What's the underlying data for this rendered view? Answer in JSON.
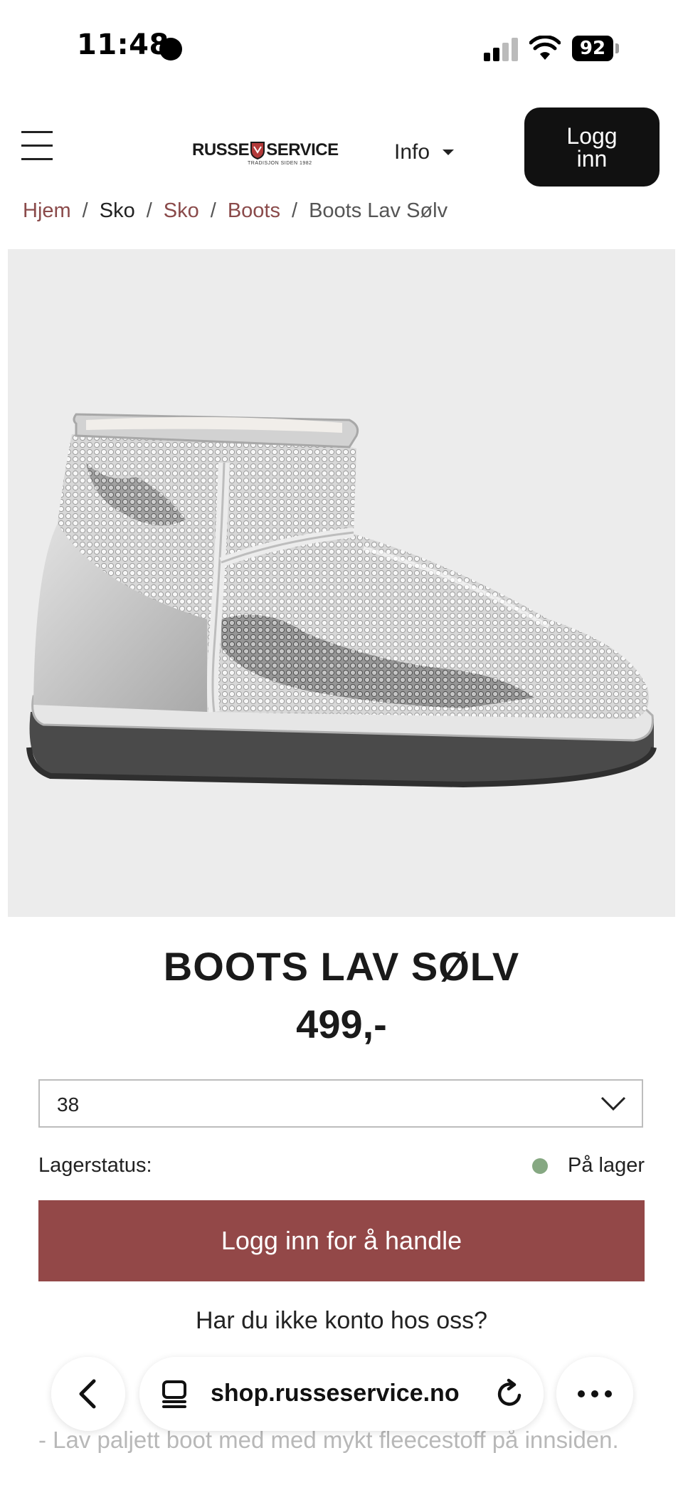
{
  "status_bar": {
    "time": "11:48",
    "battery": "92"
  },
  "header": {
    "logo": {
      "text_left": "RUSSE",
      "text_right": "SERVICE",
      "tagline": "TRADISJON SIDEN 1982"
    },
    "info_label": "Info",
    "login_label": "Logg inn"
  },
  "breadcrumb": [
    {
      "label": "Hjem"
    },
    {
      "label": "Sko"
    },
    {
      "label": "Sko"
    },
    {
      "label": "Boots"
    },
    {
      "label": "Boots Lav Sølv"
    }
  ],
  "product": {
    "title": "BOOTS LAV SØLV",
    "price": "499,-",
    "size_selected": "38",
    "stock_label": "Lagerstatus:",
    "stock_status": "På lager",
    "stock_color": "#86a882",
    "buy_label": "Logg inn for å handle",
    "no_account_text": "Har du ikke konto hos oss?",
    "description": "- Lav paljett boot med med mykt fleecestoff på innsiden."
  },
  "colors": {
    "accent": "#934848",
    "link": "#8a4a4a",
    "image_background": "#ececec"
  },
  "browser": {
    "url": "shop.russeservice.no"
  },
  "icons": {
    "menu": "hamburger-menu-icon",
    "caret": "caret-down-icon",
    "chevron": "chevron-down-icon",
    "back": "chevron-left-icon",
    "tabs": "tabs-icon",
    "reload": "reload-icon",
    "more": "more-icon"
  }
}
